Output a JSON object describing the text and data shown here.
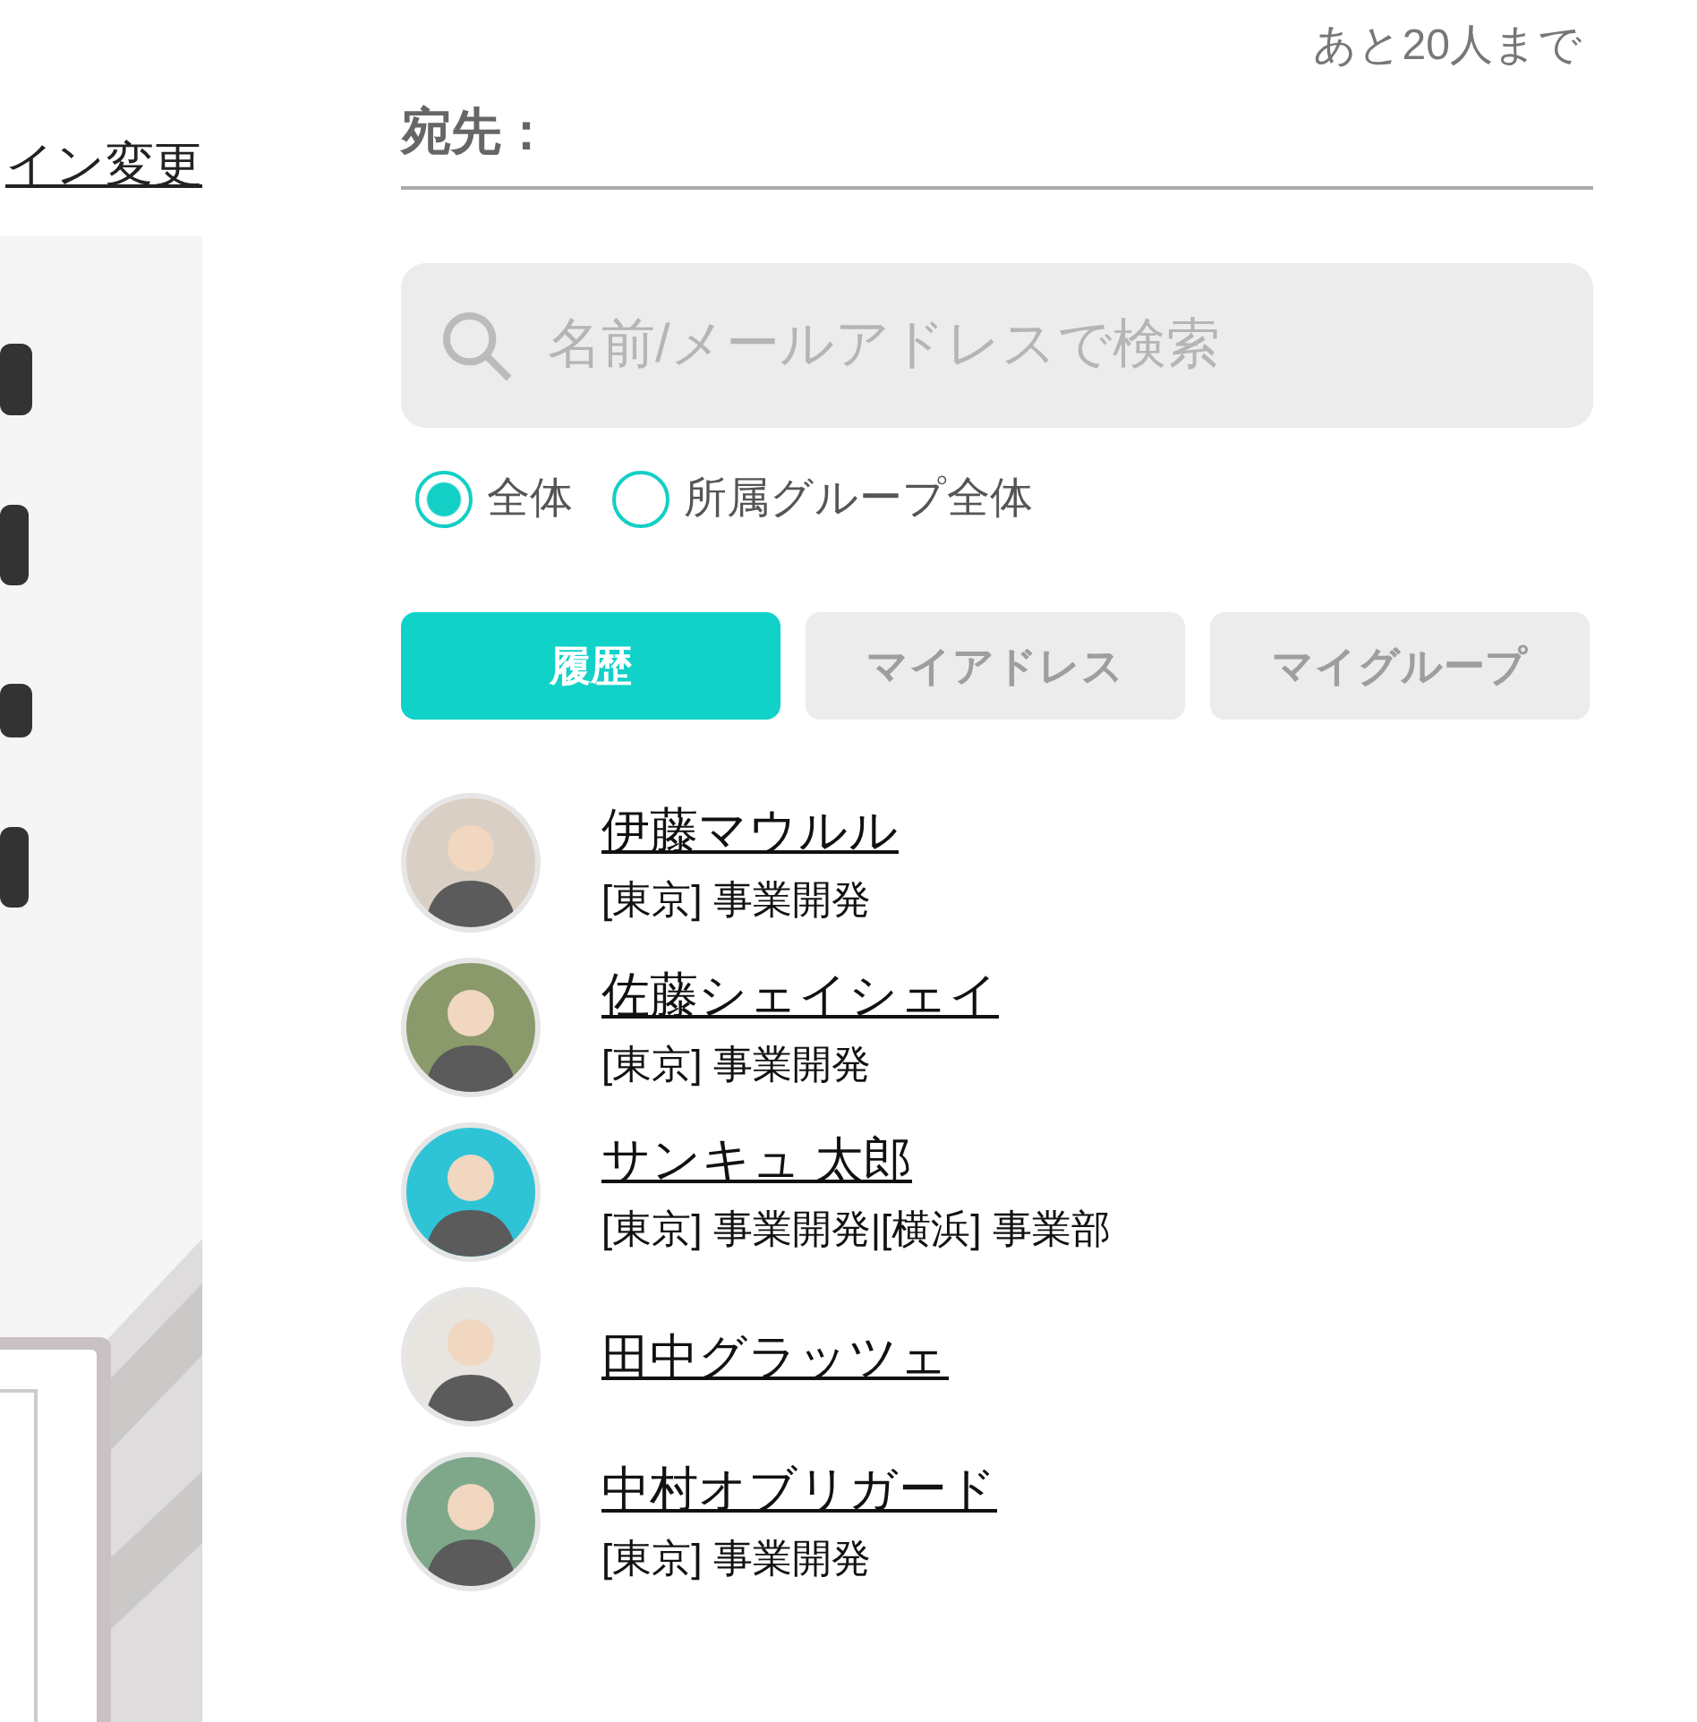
{
  "left_panel": {
    "link": "イン変更"
  },
  "remaining": "あと20人まで",
  "recipient_field": {
    "label": "宛先："
  },
  "search": {
    "placeholder": "名前/メールアドレスで検索"
  },
  "scope_options": [
    {
      "label": "全体",
      "selected": true
    },
    {
      "label": "所属グループ全体",
      "selected": false
    }
  ],
  "tabs": [
    {
      "label": "履歴",
      "selected": true
    },
    {
      "label": "マイアドレス",
      "selected": false
    },
    {
      "label": "マイグループ",
      "selected": false
    }
  ],
  "contacts": [
    {
      "name": "伊藤マウルル",
      "department": "[東京] 事業開発",
      "color": "#d9cfc4"
    },
    {
      "name": "佐藤シェイシェイ",
      "department": "[東京] 事業開発",
      "color": "#8a9a6a"
    },
    {
      "name": "サンキュ 太郎",
      "department": "[東京] 事業開発|[横浜] 事業部",
      "color": "#2ec4d6"
    },
    {
      "name": "田中グラッツェ",
      "color": "#e8e4df"
    },
    {
      "name": "中村オブリガード",
      "department": "[東京] 事業開発",
      "color": "#7fa88a"
    }
  ]
}
